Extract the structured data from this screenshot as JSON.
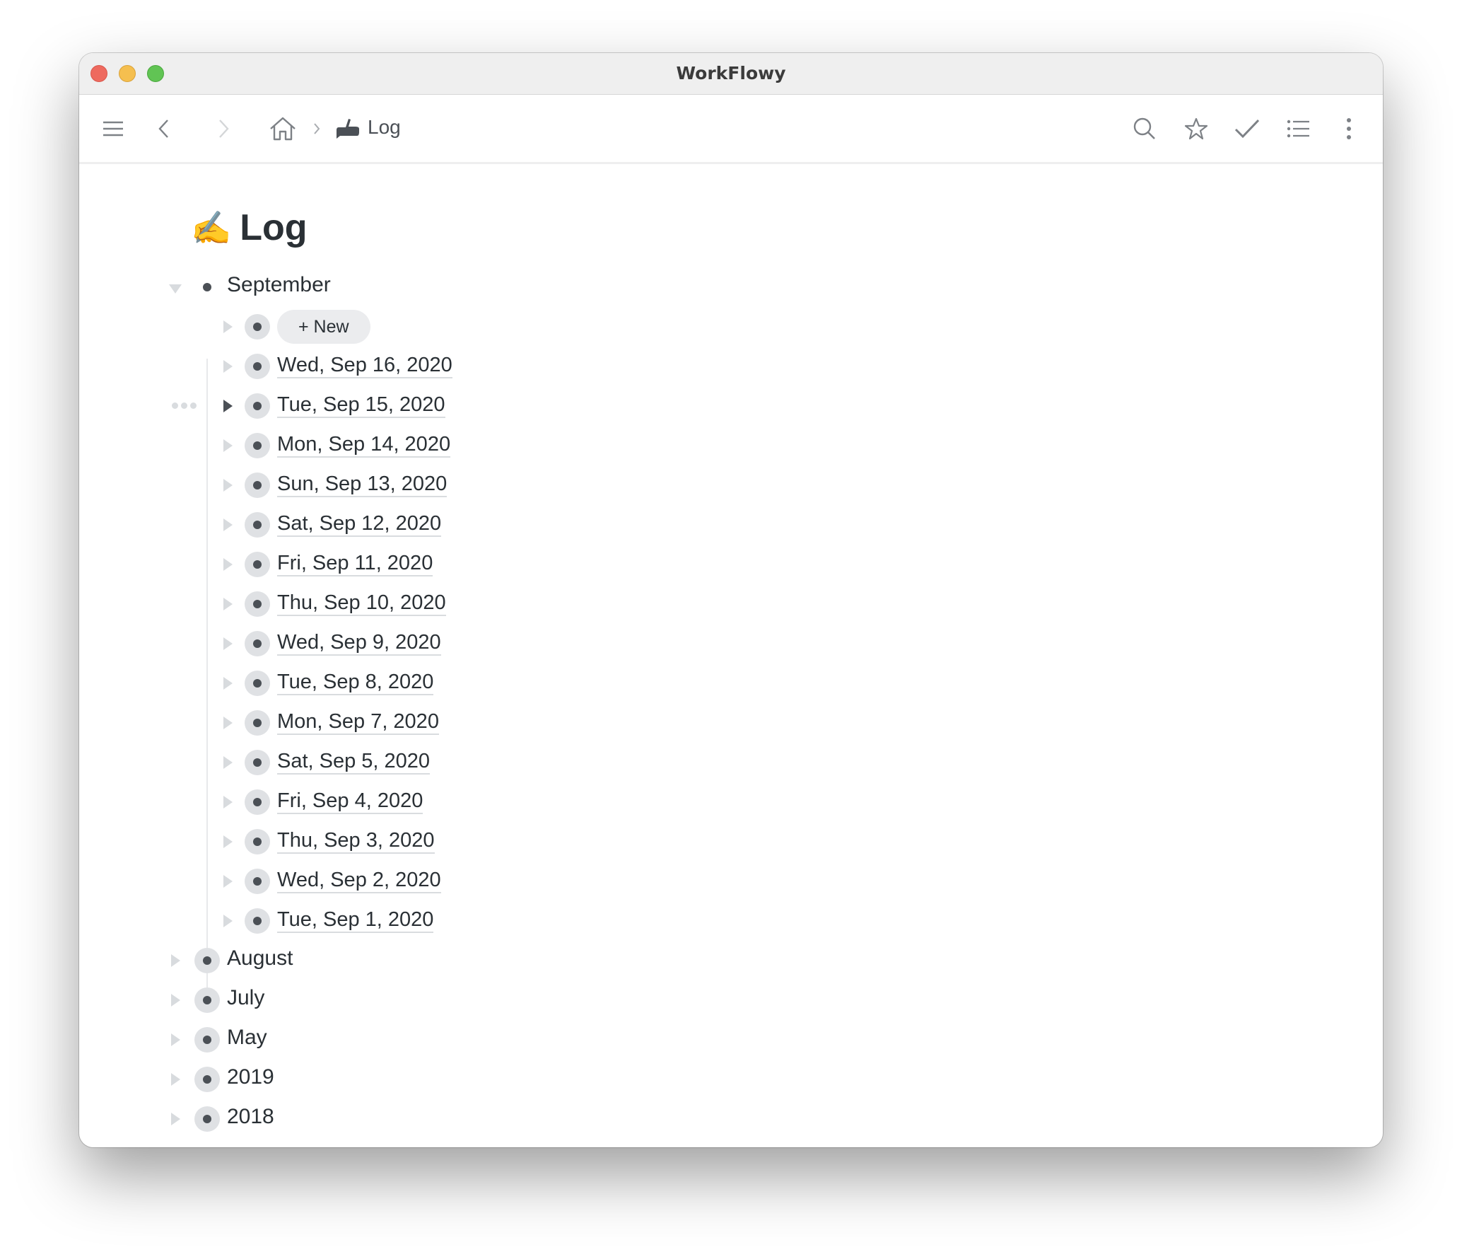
{
  "window": {
    "title": "WorkFlowy"
  },
  "toolbar": {
    "left_icons": [
      "menu-icon",
      "back-icon",
      "forward-icon",
      "home-icon"
    ],
    "breadcrumb": {
      "separator": "›",
      "current_icon": "writing-hand-icon",
      "current_label": "Log"
    },
    "right_icons": [
      "search-icon",
      "star-icon",
      "check-icon",
      "list-icon",
      "more-vertical-icon"
    ]
  },
  "page": {
    "emoji": "✍️",
    "title": "Log"
  },
  "tree": {
    "september": {
      "label": "September",
      "expanded": true,
      "new_button": "+ New",
      "children": [
        "Wed, Sep 16, 2020",
        "Tue, Sep 15, 2020",
        "Mon, Sep 14, 2020",
        "Sun, Sep 13, 2020",
        "Sat, Sep 12, 2020",
        "Fri, Sep 11, 2020",
        "Thu, Sep 10, 2020",
        "Wed, Sep 9, 2020",
        "Tue, Sep 8, 2020",
        "Mon, Sep 7, 2020",
        "Sat, Sep 5, 2020",
        "Fri, Sep 4, 2020",
        "Thu, Sep 3, 2020",
        "Wed, Sep 2, 2020",
        "Tue, Sep 1, 2020"
      ],
      "hovered_child": "Tue, Sep 15, 2020"
    },
    "collapsed_items": [
      "August",
      "July",
      "May",
      "2019",
      "2018"
    ]
  },
  "colors": {
    "text": "#2a3035",
    "icon": "#7d8186",
    "bullet": "#4b5056",
    "bullet_halo": "#dfe1e4",
    "pill_bg": "#ebecee"
  }
}
